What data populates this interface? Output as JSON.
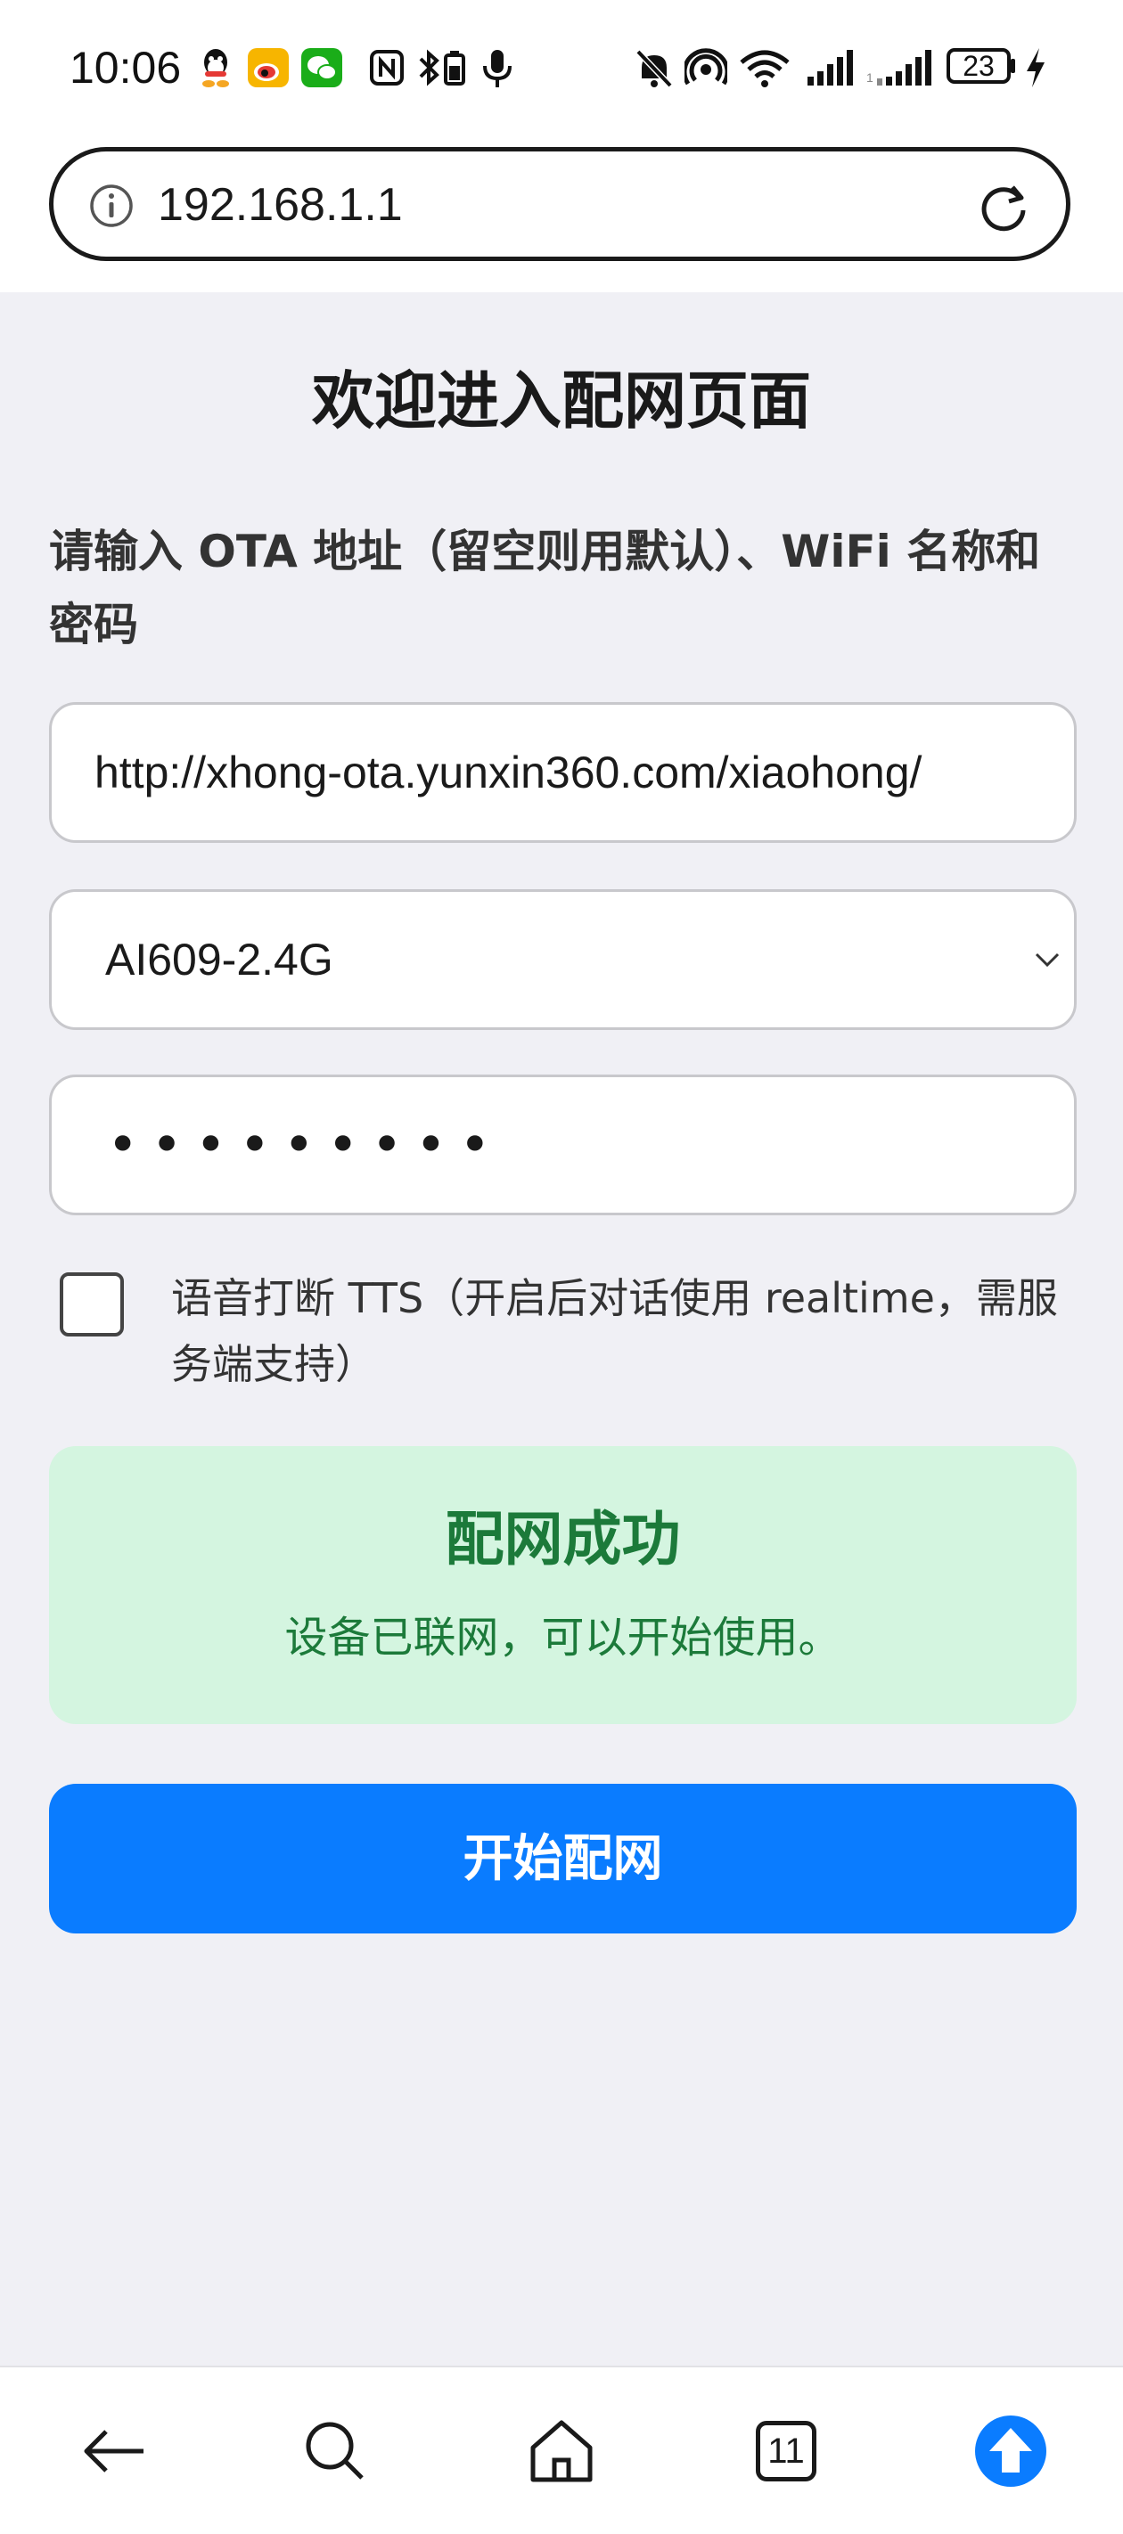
{
  "status_bar": {
    "time": "10:06",
    "battery": "23",
    "icons": [
      "qq-icon",
      "weibo-icon",
      "wechat-icon",
      "nfc-icon",
      "bluetooth-battery-icon",
      "mic-icon",
      "mute-icon",
      "hotspot-icon",
      "wifi-icon",
      "signal-icon",
      "signal-2-icon",
      "battery-icon",
      "charging-icon"
    ]
  },
  "browser": {
    "url": "192.168.1.1"
  },
  "page": {
    "title": "欢迎进入配网页面",
    "description": "请输入 OTA 地址（留空则用默认）、WiFi 名称和密码",
    "ota_value": "http://xhong-ota.yunxin360.com/xiaohong/",
    "ssid_value": "AI609-2.4G",
    "password_mask": "•••••••••",
    "tts_label": "语音打断 TTS（开启后对话使用 realtime，需服务端支持）",
    "tts_checked": false
  },
  "success": {
    "title": "配网成功",
    "message": "设备已联网，可以开始使用。"
  },
  "start_button_label": "开始配网",
  "bottom_nav": {
    "tab_count": "11"
  },
  "colors": {
    "primary": "#0a7cff",
    "success_bg": "#d4f5e0",
    "success_text": "#1c7a3a",
    "page_bg": "#f0f0f5"
  }
}
